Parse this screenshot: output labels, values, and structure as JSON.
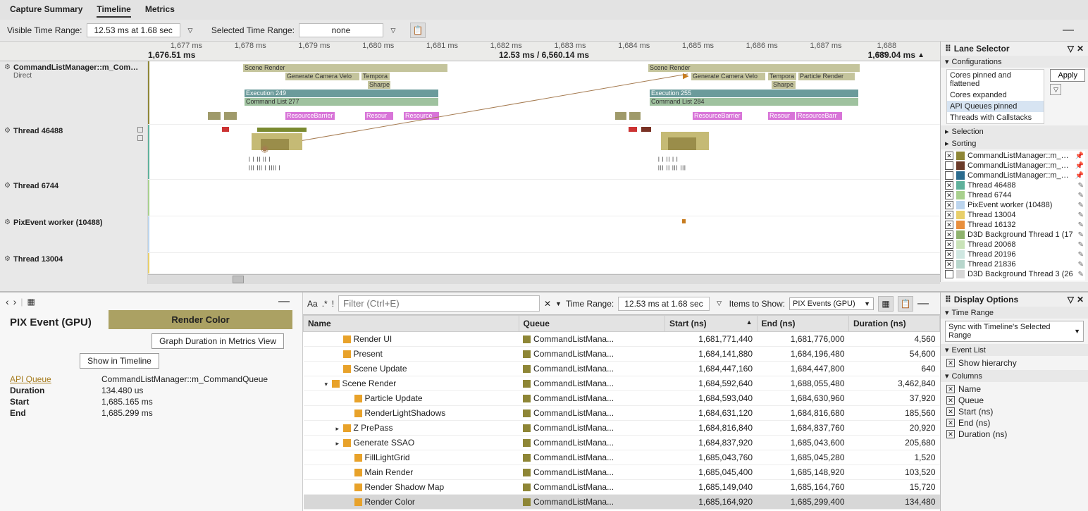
{
  "tabs": {
    "t1": "Capture Summary",
    "t2": "Timeline",
    "t3": "Metrics"
  },
  "rangebar": {
    "vis_lbl": "Visible Time Range:",
    "vis_val": "12.53 ms at 1.68 sec",
    "sel_lbl": "Selected Time Range:",
    "sel_val": "none"
  },
  "ruler": {
    "ticks": [
      "1,677 ms",
      "1,678 ms",
      "1,679 ms",
      "1,680 ms",
      "1,681 ms",
      "1,682 ms",
      "1,683 ms",
      "1,684 ms",
      "1,685 ms",
      "1,686 ms",
      "1,687 ms",
      "1,688 ms"
    ],
    "left": "1,676.51 ms",
    "center": "12.53 ms / 6,560.14 ms",
    "right": "1,689.04 ms"
  },
  "lanes": {
    "l1": {
      "name": "CommandListManager::m_CommandQueue",
      "sub": "Direct"
    },
    "l2": {
      "name": "Thread 46488"
    },
    "l3": {
      "name": "Thread 6744"
    },
    "l4": {
      "name": "PixEvent worker (10488)"
    },
    "l5": {
      "name": "Thread 13004"
    }
  },
  "blocks": {
    "scene_render": "Scene Render",
    "gen_cam": "Generate Camera Velo",
    "tempora": "Tempora",
    "sharpe": "Sharpe",
    "particle": "Particle Render",
    "exec249": "Execution 249",
    "exec255": "Execution 255",
    "cl277": "Command List 277",
    "cl284": "Command List 284",
    "rb": "ResourceBarrier",
    "rsrc": "Resourc",
    "rsrc2": "Resource",
    "rsrc3": "Resour",
    "rbarr": "ResourceBarr"
  },
  "lane_selector": {
    "title": "Lane Selector",
    "cfg_head": "Configurations",
    "cfg": [
      "Cores pinned and flattened",
      "Cores expanded",
      "API Queues pinned",
      "Threads with Callstacks"
    ],
    "apply": "Apply",
    "selection": "Selection",
    "sorting": "Sorting",
    "threads": [
      {
        "n": "CommandListManager::m_Cor",
        "c": "#8e8636",
        "ck": true,
        "pin": true
      },
      {
        "n": "CommandListManager::m_Cor",
        "c": "#6b3b2a",
        "ck": false,
        "pin": true
      },
      {
        "n": "CommandListManager::m_Cor",
        "c": "#2a6b8e",
        "ck": false,
        "pin": true
      },
      {
        "n": "Thread 46488",
        "c": "#5fb19b",
        "ck": true
      },
      {
        "n": "Thread 6744",
        "c": "#a8d08d",
        "ck": true
      },
      {
        "n": "PixEvent worker (10488)",
        "c": "#bcd5ee",
        "ck": true
      },
      {
        "n": "Thread 13004",
        "c": "#e8cf6a",
        "ck": true
      },
      {
        "n": "Thread 16132",
        "c": "#e88f3d",
        "ck": true
      },
      {
        "n": "D3D Background Thread 1 (17",
        "c": "#8fb36e",
        "ck": true
      },
      {
        "n": "Thread 20068",
        "c": "#c9e3b8",
        "ck": true
      },
      {
        "n": "Thread 20196",
        "c": "#cfe7e1",
        "ck": true
      },
      {
        "n": "Thread 21836",
        "c": "#b7d6cc",
        "ck": true
      },
      {
        "n": "D3D Background Thread 3 (26",
        "c": "#d7d7d7",
        "ck": false
      }
    ]
  },
  "detail": {
    "title": "PIX Event (GPU)",
    "big": "Render Color",
    "btn1": "Graph Duration in Metrics View",
    "btn2": "Show in Timeline",
    "rows": [
      {
        "k": "API Queue",
        "v": "CommandListManager::m_CommandQueue",
        "link": true
      },
      {
        "k": "Duration",
        "v": "134.480 us"
      },
      {
        "k": "Start",
        "v": "1,685.165 ms"
      },
      {
        "k": "End",
        "v": "1,685.299 ms"
      }
    ]
  },
  "filter": {
    "aa": "Aa",
    "re": ".*",
    "neg": "!",
    "placeholder": "Filter (Ctrl+E)",
    "tr_lbl": "Time Range:",
    "tr_val": "12.53 ms at 1.68 sec",
    "items_lbl": "Items to Show:",
    "items_val": "PIX Events (GPU)"
  },
  "table": {
    "cols": [
      "Name",
      "Queue",
      "Start (ns)",
      "End (ns)",
      "Duration (ns)"
    ],
    "rows": [
      {
        "ind": 2,
        "exp": "",
        "n": "Render UI",
        "q": "CommandListMana...",
        "s": "1,681,771,440",
        "e": "1,681,776,000",
        "d": "4,560"
      },
      {
        "ind": 2,
        "exp": "",
        "n": "Present",
        "q": "CommandListMana...",
        "s": "1,684,141,880",
        "e": "1,684,196,480",
        "d": "54,600"
      },
      {
        "ind": 2,
        "exp": "",
        "n": "Scene Update",
        "q": "CommandListMana...",
        "s": "1,684,447,160",
        "e": "1,684,447,800",
        "d": "640"
      },
      {
        "ind": 1,
        "exp": "▾",
        "n": "Scene Render",
        "q": "CommandListMana...",
        "s": "1,684,592,640",
        "e": "1,688,055,480",
        "d": "3,462,840"
      },
      {
        "ind": 3,
        "exp": "",
        "n": "Particle Update",
        "q": "CommandListMana...",
        "s": "1,684,593,040",
        "e": "1,684,630,960",
        "d": "37,920"
      },
      {
        "ind": 3,
        "exp": "",
        "n": "RenderLightShadows",
        "q": "CommandListMana...",
        "s": "1,684,631,120",
        "e": "1,684,816,680",
        "d": "185,560"
      },
      {
        "ind": 2,
        "exp": "▸",
        "n": "Z PrePass",
        "q": "CommandListMana...",
        "s": "1,684,816,840",
        "e": "1,684,837,760",
        "d": "20,920"
      },
      {
        "ind": 2,
        "exp": "▸",
        "n": "Generate SSAO",
        "q": "CommandListMana...",
        "s": "1,684,837,920",
        "e": "1,685,043,600",
        "d": "205,680"
      },
      {
        "ind": 3,
        "exp": "",
        "n": "FillLightGrid",
        "q": "CommandListMana...",
        "s": "1,685,043,760",
        "e": "1,685,045,280",
        "d": "1,520"
      },
      {
        "ind": 3,
        "exp": "",
        "n": "Main Render",
        "q": "CommandListMana...",
        "s": "1,685,045,400",
        "e": "1,685,148,920",
        "d": "103,520"
      },
      {
        "ind": 3,
        "exp": "",
        "n": "Render Shadow Map",
        "q": "CommandListMana...",
        "s": "1,685,149,040",
        "e": "1,685,164,760",
        "d": "15,720"
      },
      {
        "ind": 3,
        "exp": "",
        "n": "Render Color",
        "q": "CommandListMana...",
        "s": "1,685,164,920",
        "e": "1,685,299,400",
        "d": "134,480",
        "sel": true
      }
    ]
  },
  "disp": {
    "title": "Display Options",
    "tr": "Time Range",
    "sync": "Sync with Timeline's Selected Range",
    "el": "Event List",
    "hier": "Show hierarchy",
    "cols_h": "Columns",
    "cols": [
      "Name",
      "Queue",
      "Start (ns)",
      "End (ns)",
      "Duration (ns)"
    ]
  }
}
